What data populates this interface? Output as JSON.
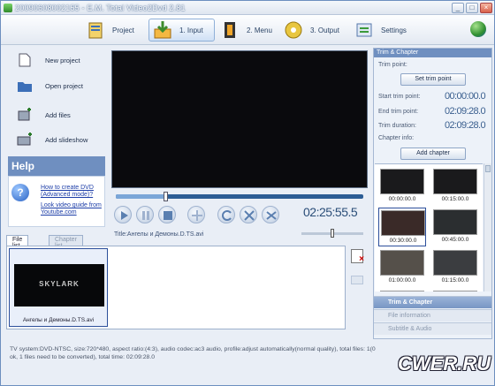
{
  "window": {
    "title": "20090608002155 - E.M. Total Video2Dvd 2.81",
    "min": "_",
    "max": "□",
    "close": "×"
  },
  "toolbar": {
    "project": "Project",
    "input": "1. Input",
    "menu": "2. Menu",
    "output": "3. Output",
    "settings": "Settings"
  },
  "left": {
    "new_project": "New project",
    "open_project": "Open project",
    "add_files": "Add files",
    "add_slideshow": "Add slideshow",
    "help_title": "Help",
    "link1": "How to create DVD (Advanced mode)?",
    "link2": "Look video guide from Youtube.com"
  },
  "player": {
    "timecode": "02:25:55.5",
    "file_title": "Title:Ангелы и Демоны.D.TS.avi",
    "seek_fraction": 0.2,
    "volume_fraction": 0.5
  },
  "tabs": {
    "file_list": "File list",
    "chapter_list": "Chapter list"
  },
  "files": [
    {
      "label": "Ангелы и Демоны.D.TS.avi",
      "thumb_text": "SKYLARK"
    }
  ],
  "right": {
    "header": "Trim & Chapter",
    "trim_point": "Trim point:",
    "set_trim": "Set trim point",
    "start_lbl": "Start trim point:",
    "start_val": "00:00:00.0",
    "end_lbl": "End trim point:",
    "end_val": "02:09:28.0",
    "dur_lbl": "Trim duration:",
    "dur_val": "02:09:28.0",
    "chapter_info": "Chapter info:",
    "add_chapter": "Add chapter",
    "chapters": [
      "00:00:00.0",
      "00:15:00.0",
      "00:30:00.0",
      "00:45:00.0",
      "01:00:00.0",
      "01:15:00.0",
      "",
      ""
    ],
    "sections": [
      "Trim & Chapter",
      "File information",
      "Subtitle & Audio"
    ]
  },
  "status": {
    "line1": "TV system:DVD-NTSC, size:720*480, aspect ratio:(4:3), audio codec:ac3 audio, profile:adjust automatically(normal quality), total files: 1(0 ",
    "line2": "ok, 1 files need to be converted), total time: 02:09:28.0"
  },
  "watermark": "CWER.RU",
  "colors": {
    "accent": "#6f8fc0",
    "video_bg": "#0a0a0d",
    "timecode": "#2a4d78"
  }
}
